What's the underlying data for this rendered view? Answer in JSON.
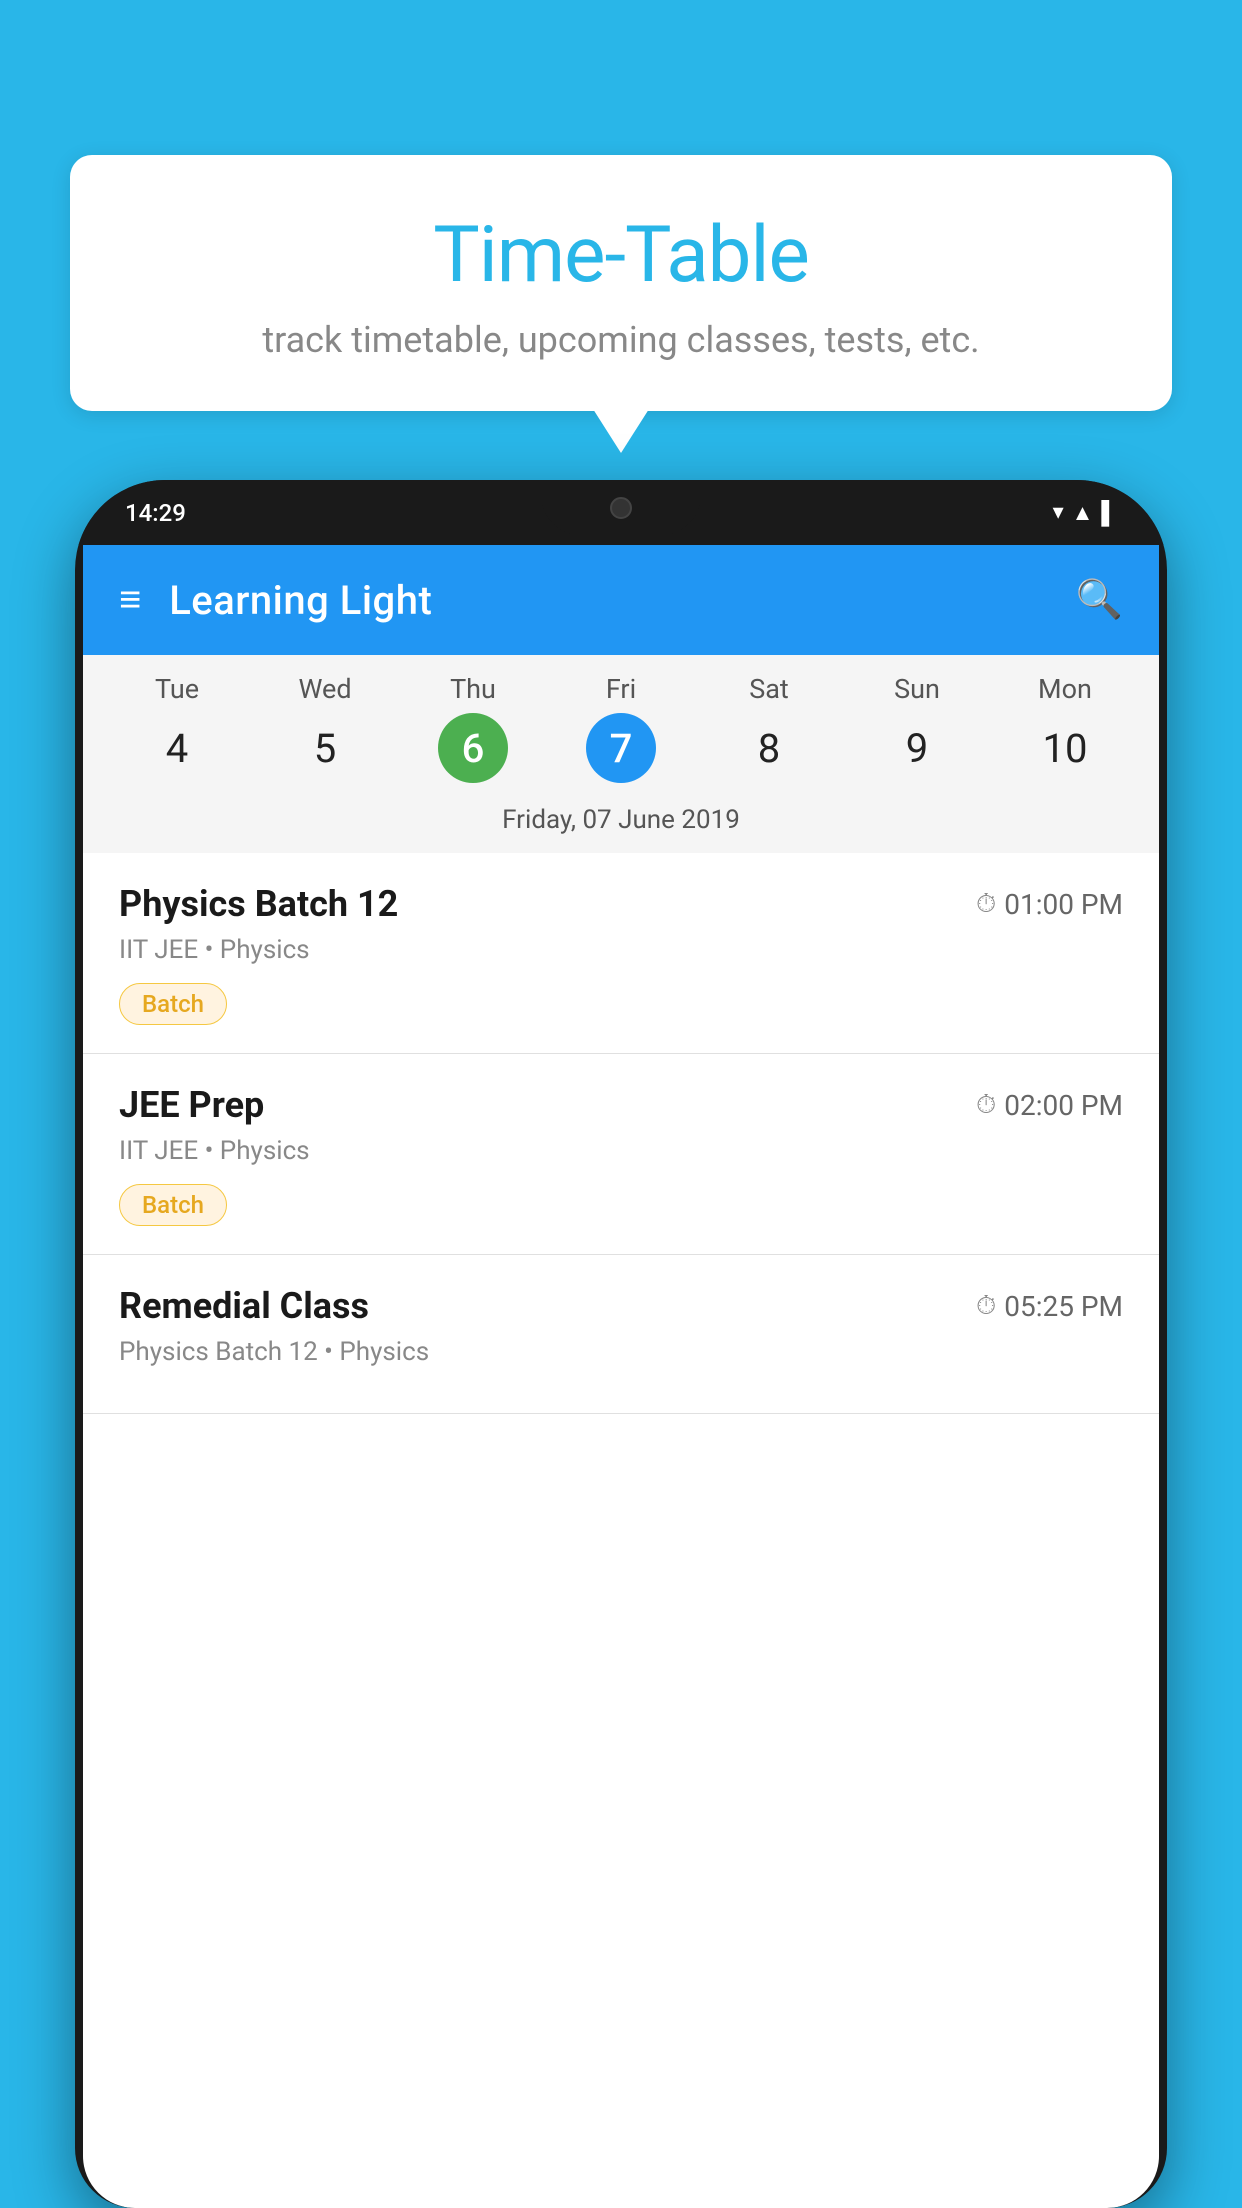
{
  "background_color": "#29b6e8",
  "bubble": {
    "title": "Time-Table",
    "subtitle": "track timetable, upcoming classes, tests, etc."
  },
  "status_bar": {
    "time": "14:29",
    "icons": "▼ ▲ ▌"
  },
  "app_bar": {
    "title": "Learning Light",
    "hamburger_label": "≡",
    "search_label": "🔍"
  },
  "calendar": {
    "days": [
      {
        "name": "Tue",
        "number": "4",
        "state": "normal"
      },
      {
        "name": "Wed",
        "number": "5",
        "state": "normal"
      },
      {
        "name": "Thu",
        "number": "6",
        "state": "today"
      },
      {
        "name": "Fri",
        "number": "7",
        "state": "selected"
      },
      {
        "name": "Sat",
        "number": "8",
        "state": "normal"
      },
      {
        "name": "Sun",
        "number": "9",
        "state": "normal"
      },
      {
        "name": "Mon",
        "number": "10",
        "state": "normal"
      }
    ],
    "selected_date_label": "Friday, 07 June 2019"
  },
  "schedule": {
    "items": [
      {
        "title": "Physics Batch 12",
        "time": "01:00 PM",
        "subtitle": "IIT JEE • Physics",
        "tag": "Batch"
      },
      {
        "title": "JEE Prep",
        "time": "02:00 PM",
        "subtitle": "IIT JEE • Physics",
        "tag": "Batch"
      },
      {
        "title": "Remedial Class",
        "time": "05:25 PM",
        "subtitle": "Physics Batch 12 • Physics",
        "tag": null
      }
    ]
  }
}
